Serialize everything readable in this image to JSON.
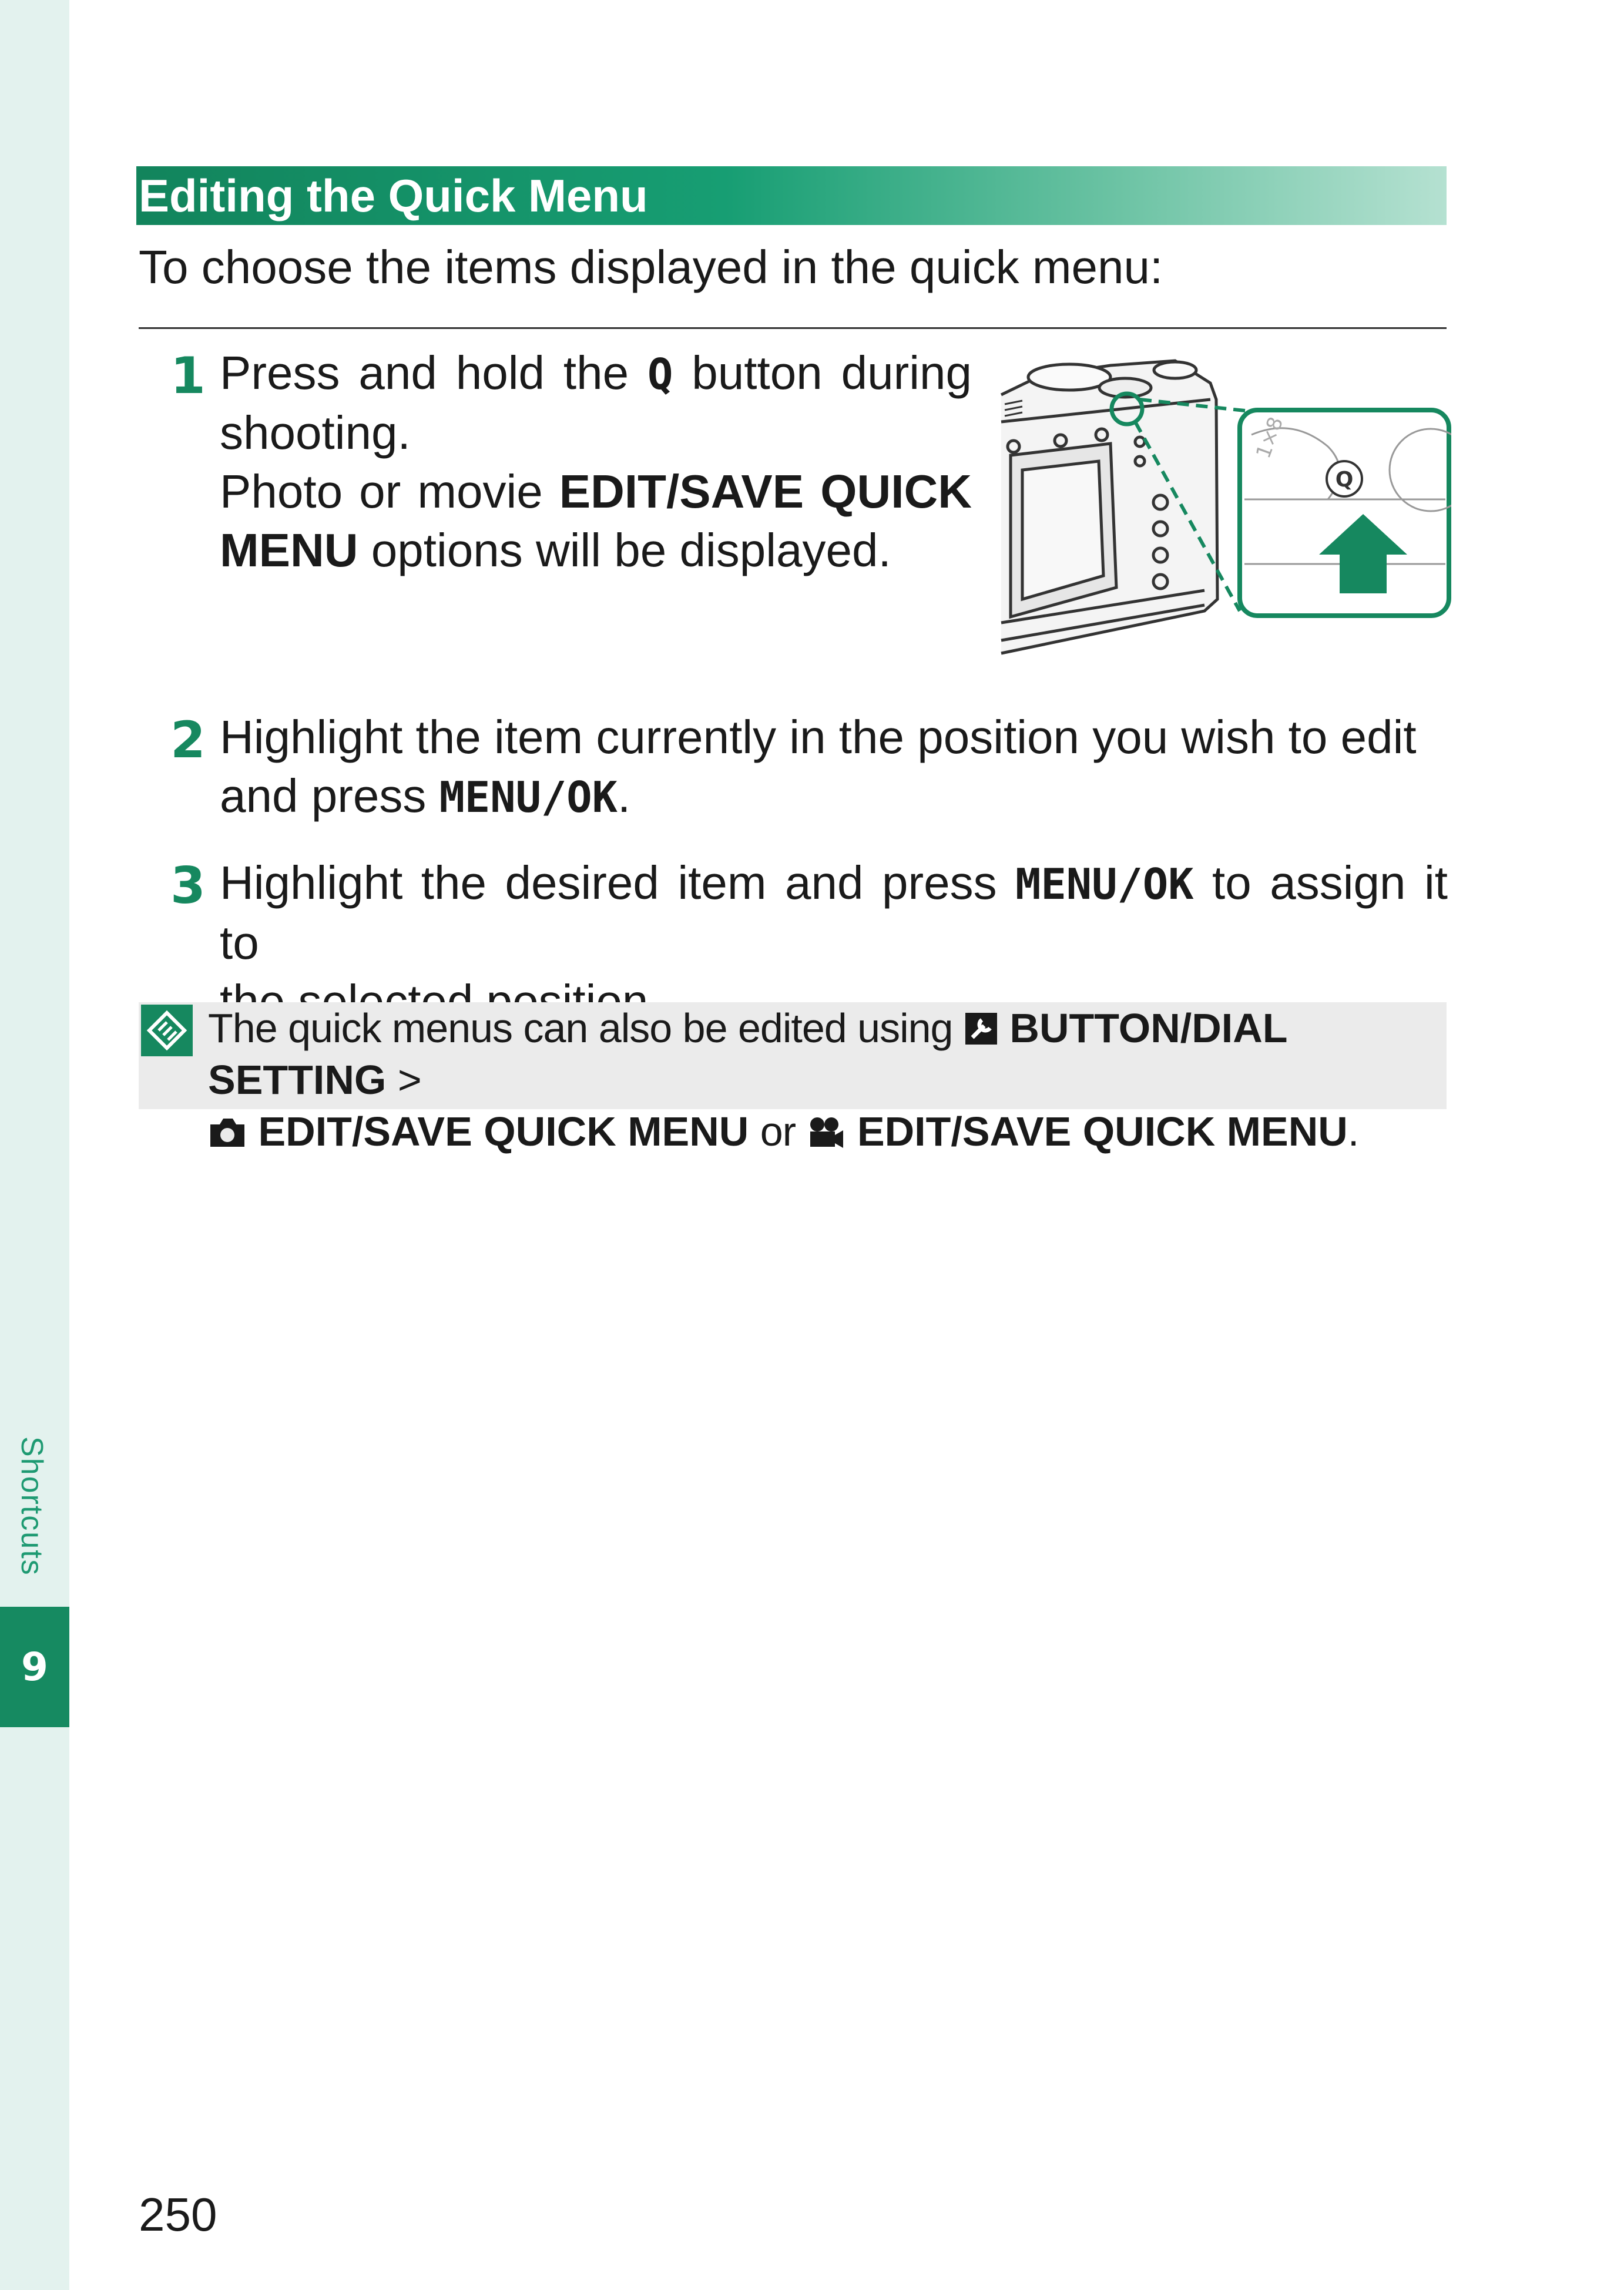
{
  "sidebar": {
    "chapter_label": "Shortcuts",
    "chapter_number": "9"
  },
  "section": {
    "heading": "Editing the Quick Menu",
    "intro": "To choose the items displayed in the quick menu:"
  },
  "steps": [
    {
      "number": "1",
      "line1_pre": "Press and hold the",
      "line1_key": "Q",
      "line1_post": "button during",
      "line2": "shooting.",
      "line3_pre": "Photo or movie",
      "line3_bold": "EDIT/SAVE QUICK",
      "line4_bold": "MENU",
      "line4_post": "options will be displayed."
    },
    {
      "number": "2",
      "line1": "Highlight the item currently in the position you wish to edit",
      "line2_pre": "and press",
      "line2_key": "MENU/OK",
      "line2_post": "."
    },
    {
      "number": "3",
      "line1_pre": "Highlight the desired item and press",
      "line1_key": "MENU/OK",
      "line1_post": "to assign it to",
      "line2": "the selected position."
    }
  ],
  "illustration": {
    "button_label": "Q",
    "dial_marks": "1×8"
  },
  "note": {
    "line1_pre": "The quick menus can also be edited using",
    "line1_bold": "BUTTON/DIAL SETTING",
    "line1_post": ">",
    "line2_bold1": "EDIT/SAVE QUICK MENU",
    "line2_or": "or",
    "line2_bold2": "EDIT/SAVE QUICK MENU",
    "line2_post": "."
  },
  "footer": {
    "page_number": "250"
  },
  "colors": {
    "accent": "#168a61",
    "side_strip": "#e3f2ee",
    "note_background": "#ebebeb"
  },
  "icons": {
    "note": "note-pencil-icon",
    "setup": "wrench-icon",
    "still": "camera-icon",
    "movie": "movie-camera-icon",
    "button_press": "arrow-up-icon"
  }
}
